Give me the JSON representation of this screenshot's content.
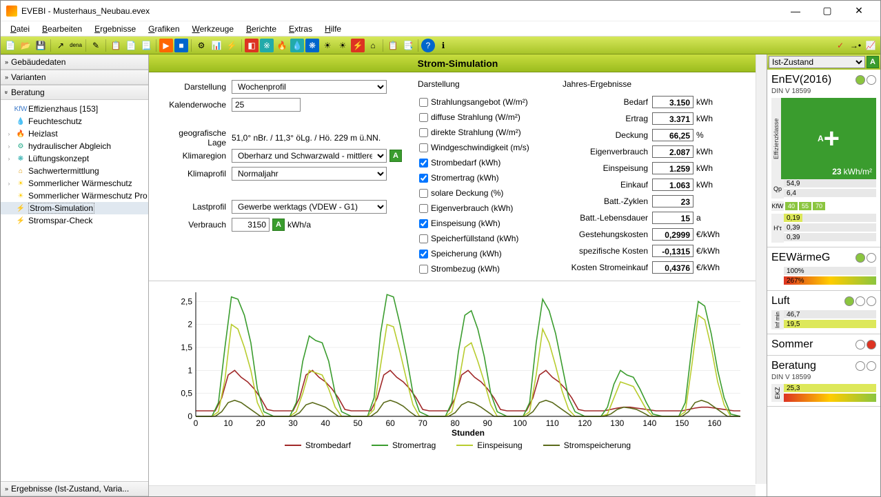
{
  "window": {
    "title": "EVEBI - Musterhaus_Neubau.evex"
  },
  "menu": [
    "Datei",
    "Bearbeiten",
    "Ergebnisse",
    "Grafiken",
    "Werkzeuge",
    "Berichte",
    "Extras",
    "Hilfe"
  ],
  "left": {
    "acc1": "Gebäudedaten",
    "acc2": "Varianten",
    "acc3": "Beratung",
    "acc4": "Ergebnisse (Ist-Zustand, Varia...",
    "tree": [
      {
        "label": "Effizienzhaus [153]",
        "icon": "KfW",
        "color": "#3a78c8"
      },
      {
        "label": "Feuchteschutz",
        "icon": "💧",
        "color": "#3a78c8"
      },
      {
        "label": "Heizlast",
        "icon": "🔥",
        "color": "#d32",
        "exp": true
      },
      {
        "label": "hydraulischer Abgleich",
        "icon": "⚙",
        "color": "#2a8",
        "exp": true
      },
      {
        "label": "Lüftungskonzept",
        "icon": "❋",
        "color": "#2aa",
        "exp": true
      },
      {
        "label": "Sachwertermittlung",
        "icon": "⌂",
        "color": "#d90"
      },
      {
        "label": "Sommerlicher Wärmeschutz",
        "icon": "☀",
        "color": "#fc0",
        "exp": true
      },
      {
        "label": "Sommerlicher Wärmeschutz Pro",
        "icon": "☀",
        "color": "#fc0"
      },
      {
        "label": "Strom-Simulation",
        "icon": "⚡",
        "color": "#d32",
        "sel": true
      },
      {
        "label": "Stromspar-Check",
        "icon": "⚡",
        "color": "#d32"
      }
    ]
  },
  "center": {
    "title": "Strom-Simulation",
    "labels": {
      "darstellung": "Darstellung",
      "kalenderwoche": "Kalenderwoche",
      "geolage": "geografische Lage",
      "klimaregion": "Klimaregion",
      "klimaprofil": "Klimaprofil",
      "lastprofil": "Lastprofil",
      "verbrauch": "Verbrauch"
    },
    "values": {
      "darstellung": "Wochenprofil",
      "kalenderwoche": "25",
      "geolage": "51,0° nBr. / 11,3° öLg. / Hö. 229 m ü.NN.",
      "klimaregion": "Oberharz und Schwarzwald - mittlere Lagen",
      "klimaprofil": "Normaljahr",
      "lastprofil": "Gewerbe werktags (VDEW - G1)",
      "verbrauch": "3150",
      "verbrauch_unit": "kWh/a"
    },
    "chk_title": "Darstellung",
    "chk": [
      {
        "l": "Strahlungsangebot (W/m²)",
        "c": false
      },
      {
        "l": "diffuse Strahlung (W/m²)",
        "c": false
      },
      {
        "l": "direkte Strahlung (W/m²)",
        "c": false
      },
      {
        "l": "Windgeschwindigkeit (m/s)",
        "c": false
      },
      {
        "l": "Strombedarf (kWh)",
        "c": true
      },
      {
        "l": "Stromertrag (kWh)",
        "c": true
      },
      {
        "l": "solare Deckung (%)",
        "c": false
      },
      {
        "l": "Eigenverbrauch (kWh)",
        "c": false
      },
      {
        "l": "Einspeisung (kWh)",
        "c": true
      },
      {
        "l": "Speicherfüllstand (kWh)",
        "c": false
      },
      {
        "l": "Speicherung (kWh)",
        "c": true
      },
      {
        "l": "Strombezug (kWh)",
        "c": false
      }
    ],
    "res_title": "Jahres-Ergebnisse",
    "res": [
      {
        "l": "Bedarf",
        "v": "3.150",
        "u": "kWh"
      },
      {
        "l": "Ertrag",
        "v": "3.371",
        "u": "kWh"
      },
      {
        "l": "Deckung",
        "v": "66,25",
        "u": "%"
      },
      {
        "l": "Eigenverbrauch",
        "v": "2.087",
        "u": "kWh"
      },
      {
        "l": "Einspeisung",
        "v": "1.259",
        "u": "kWh"
      },
      {
        "l": "Einkauf",
        "v": "1.063",
        "u": "kWh"
      },
      {
        "l": "Batt.-Zyklen",
        "v": "23",
        "u": ""
      },
      {
        "l": "Batt.-Lebensdauer",
        "v": "15",
        "u": "a"
      },
      {
        "l": "Gestehungskosten",
        "v": "0,2999",
        "u": "€/kWh"
      },
      {
        "l": "spezifische Kosten",
        "v": "-0,1315",
        "u": "€/kWh"
      },
      {
        "l": "Kosten Stromeinkauf",
        "v": "0,4376",
        "u": "€/kWh"
      }
    ],
    "legend": [
      "Strombedarf",
      "Stromertrag",
      "Einspeisung",
      "Stromspeicherung"
    ],
    "xlabel": "Stunden"
  },
  "right": {
    "dropdown": "Ist-Zustand",
    "enev": {
      "h": "EnEV(2016)",
      "sub": "DIN V 18599",
      "eff_lbl": "Effizienzklasse",
      "grade": "A",
      "plus": "+",
      "kwh": "23",
      "kwh_u": "kWh/m²"
    },
    "qp": {
      "lbl": "Qp",
      "v1": "54,9",
      "v2": "6,4"
    },
    "kfw": {
      "lbl": "KfW",
      "chips": [
        "40",
        "55",
        "70"
      ]
    },
    "ht": {
      "lbl": "H'τ",
      "v1": "0,19",
      "v2": "0,39",
      "v3": "0,39"
    },
    "eew": {
      "h": "EEWärmeG",
      "v1": "100%",
      "v2": "267%"
    },
    "luft": {
      "h": "Luft",
      "lbl": "Inf min",
      "v1": "46,7",
      "v2": "19,5"
    },
    "sommer": {
      "h": "Sommer"
    },
    "beratung": {
      "h": "Beratung",
      "sub": "DIN V 18599",
      "lbl": "EKZ",
      "v": "25,3"
    }
  },
  "chart_data": {
    "type": "line",
    "xlabel": "Stunden",
    "ylabel": "",
    "ylim": [
      0,
      2.7
    ],
    "xlim": [
      0,
      168
    ],
    "x_ticks": [
      0,
      10,
      20,
      30,
      40,
      50,
      60,
      70,
      80,
      90,
      100,
      110,
      120,
      130,
      140,
      150,
      160
    ],
    "y_ticks": [
      0,
      0.5,
      1,
      1.5,
      2,
      2.5
    ],
    "series": [
      {
        "name": "Strombedarf",
        "color": "#a02828",
        "x": [
          0,
          6,
          8,
          10,
          12,
          14,
          16,
          18,
          20,
          22,
          24,
          30,
          32,
          34,
          36,
          38,
          40,
          42,
          44,
          46,
          48,
          54,
          56,
          58,
          60,
          62,
          64,
          66,
          68,
          70,
          72,
          78,
          80,
          82,
          84,
          86,
          88,
          90,
          92,
          94,
          96,
          102,
          104,
          106,
          108,
          110,
          112,
          114,
          116,
          118,
          120,
          126,
          128,
          130,
          132,
          134,
          136,
          138,
          140,
          142,
          144,
          150,
          152,
          154,
          156,
          158,
          160,
          162,
          164,
          166,
          168
        ],
        "y": [
          0.12,
          0.12,
          0.4,
          0.9,
          1.0,
          0.85,
          0.75,
          0.6,
          0.4,
          0.15,
          0.12,
          0.12,
          0.4,
          0.9,
          1.0,
          0.85,
          0.75,
          0.6,
          0.4,
          0.15,
          0.12,
          0.12,
          0.4,
          0.9,
          1.0,
          0.85,
          0.75,
          0.6,
          0.4,
          0.15,
          0.12,
          0.12,
          0.4,
          0.9,
          1.0,
          0.85,
          0.75,
          0.6,
          0.4,
          0.15,
          0.12,
          0.12,
          0.4,
          0.9,
          1.0,
          0.85,
          0.75,
          0.6,
          0.4,
          0.15,
          0.12,
          0.12,
          0.15,
          0.18,
          0.2,
          0.2,
          0.18,
          0.16,
          0.14,
          0.12,
          0.12,
          0.12,
          0.15,
          0.18,
          0.2,
          0.2,
          0.18,
          0.16,
          0.14,
          0.12,
          0.12
        ]
      },
      {
        "name": "Stromertrag",
        "color": "#3a9c2e",
        "x": [
          0,
          5,
          7,
          9,
          11,
          13,
          15,
          17,
          19,
          21,
          24,
          29,
          31,
          33,
          35,
          37,
          39,
          41,
          43,
          45,
          48,
          53,
          55,
          57,
          59,
          61,
          63,
          65,
          67,
          69,
          72,
          77,
          79,
          81,
          83,
          85,
          87,
          89,
          91,
          93,
          96,
          101,
          103,
          105,
          107,
          109,
          111,
          113,
          115,
          117,
          120,
          125,
          127,
          129,
          131,
          133,
          135,
          137,
          139,
          141,
          144,
          149,
          151,
          153,
          155,
          157,
          159,
          161,
          163,
          165,
          168
        ],
        "y": [
          0,
          0,
          0.3,
          1.5,
          2.6,
          2.55,
          2.2,
          1.6,
          0.6,
          0.1,
          0,
          0,
          0.3,
          1.2,
          1.75,
          1.65,
          1.6,
          1.2,
          0.5,
          0.1,
          0,
          0,
          0.4,
          1.8,
          2.65,
          2.6,
          2.0,
          1.3,
          0.5,
          0.1,
          0,
          0,
          0.3,
          1.4,
          2.2,
          2.3,
          1.9,
          1.3,
          0.5,
          0.1,
          0,
          0,
          0.3,
          1.6,
          2.55,
          2.3,
          1.8,
          1.1,
          0.4,
          0.1,
          0,
          0,
          0.2,
          0.7,
          1.0,
          0.9,
          0.85,
          0.6,
          0.3,
          0.05,
          0,
          0,
          0.3,
          1.5,
          2.5,
          2.4,
          1.8,
          1.0,
          0.4,
          0.05,
          0
        ]
      },
      {
        "name": "Einspeisung",
        "color": "#b8cc2e",
        "x": [
          0,
          5,
          7,
          9,
          11,
          13,
          15,
          17,
          19,
          21,
          24,
          29,
          31,
          33,
          35,
          37,
          39,
          41,
          43,
          45,
          48,
          53,
          55,
          57,
          59,
          61,
          63,
          65,
          67,
          69,
          72,
          77,
          79,
          81,
          83,
          85,
          87,
          89,
          91,
          93,
          96,
          101,
          103,
          105,
          107,
          109,
          111,
          113,
          115,
          117,
          120,
          125,
          127,
          129,
          131,
          133,
          135,
          137,
          139,
          141,
          144,
          149,
          151,
          153,
          155,
          157,
          159,
          161,
          163,
          165,
          168
        ],
        "y": [
          0,
          0,
          0.1,
          0.8,
          2.0,
          1.9,
          1.5,
          1.0,
          0.3,
          0,
          0,
          0,
          0.1,
          0.5,
          1.0,
          0.95,
          0.9,
          0.6,
          0.2,
          0,
          0,
          0,
          0.15,
          1.1,
          2.0,
          1.95,
          1.4,
          0.8,
          0.25,
          0,
          0,
          0,
          0.1,
          0.7,
          1.5,
          1.6,
          1.2,
          0.75,
          0.25,
          0,
          0,
          0,
          0.1,
          0.9,
          1.9,
          1.6,
          1.1,
          0.55,
          0.15,
          0,
          0,
          0,
          0.05,
          0.4,
          0.75,
          0.7,
          0.65,
          0.4,
          0.15,
          0,
          0,
          0,
          0.1,
          1.1,
          2.2,
          2.1,
          1.5,
          0.75,
          0.25,
          0,
          0
        ]
      },
      {
        "name": "Stromspeicherung",
        "color": "#5a6a1a",
        "x": [
          0,
          6,
          8,
          10,
          12,
          14,
          16,
          18,
          20,
          24,
          30,
          32,
          34,
          36,
          38,
          40,
          42,
          44,
          48,
          54,
          56,
          58,
          60,
          62,
          64,
          66,
          68,
          72,
          78,
          80,
          82,
          84,
          86,
          88,
          90,
          92,
          96,
          102,
          104,
          106,
          108,
          110,
          112,
          114,
          116,
          120,
          126,
          128,
          130,
          132,
          134,
          136,
          138,
          140,
          144,
          150,
          152,
          154,
          156,
          158,
          160,
          162,
          164,
          168
        ],
        "y": [
          0,
          0,
          0.1,
          0.3,
          0.35,
          0.3,
          0.2,
          0.1,
          0,
          0,
          0,
          0.08,
          0.25,
          0.3,
          0.25,
          0.2,
          0.1,
          0,
          0,
          0,
          0.1,
          0.3,
          0.35,
          0.3,
          0.22,
          0.1,
          0,
          0,
          0,
          0.08,
          0.25,
          0.32,
          0.28,
          0.2,
          0.1,
          0,
          0,
          0,
          0.1,
          0.3,
          0.35,
          0.3,
          0.2,
          0.1,
          0,
          0,
          0,
          0.05,
          0.15,
          0.2,
          0.18,
          0.15,
          0.08,
          0,
          0,
          0,
          0.1,
          0.3,
          0.35,
          0.3,
          0.2,
          0.1,
          0,
          0
        ]
      }
    ]
  }
}
